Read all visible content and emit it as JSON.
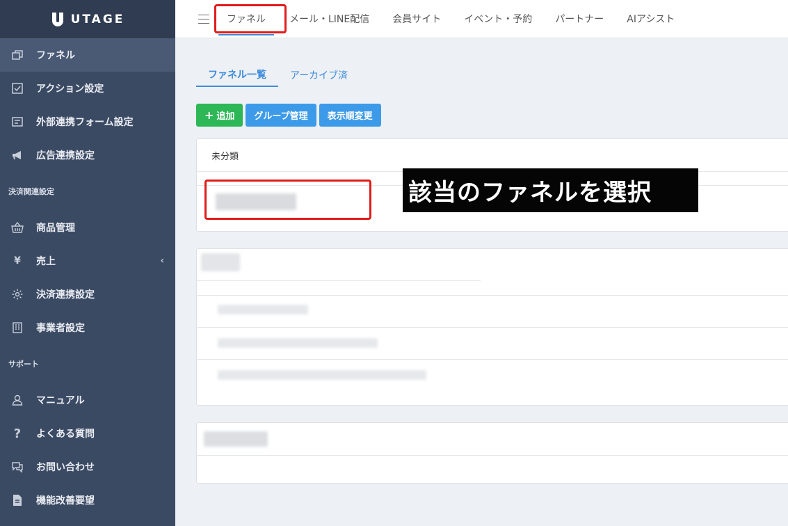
{
  "app": {
    "logo_text": "UTAGE"
  },
  "sidebar": {
    "items": [
      {
        "label": "ファネル",
        "icon": "copy-icon",
        "active": true
      },
      {
        "label": "アクション設定",
        "icon": "checkbox-icon"
      },
      {
        "label": "外部連携フォーム設定",
        "icon": "form-icon"
      },
      {
        "label": "広告連携設定",
        "icon": "megaphone-icon"
      }
    ],
    "section_payment": "決済関連設定",
    "payment_items": [
      {
        "label": "商品管理",
        "icon": "basket-icon"
      },
      {
        "label": "売上",
        "icon": "yen-icon",
        "chevron": "‹"
      },
      {
        "label": "決済連携設定",
        "icon": "gear-icon"
      },
      {
        "label": "事業者設定",
        "icon": "building-icon"
      }
    ],
    "section_support": "サポート",
    "support_items": [
      {
        "label": "マニュアル",
        "icon": "user-icon"
      },
      {
        "label": "よくある質問",
        "icon": "question-icon"
      },
      {
        "label": "お問い合わせ",
        "icon": "chat-icon"
      },
      {
        "label": "機能改善要望",
        "icon": "document-icon"
      }
    ]
  },
  "topnav": {
    "items": [
      "ファネル",
      "メール・LINE配信",
      "会員サイト",
      "イベント・予約",
      "パートナー",
      "AIアシスト"
    ]
  },
  "tabs": [
    "ファネル一覧",
    "アーカイブ済"
  ],
  "toolbar": {
    "add_label": "追加",
    "group_label": "グループ管理",
    "order_label": "表示順変更"
  },
  "card1": {
    "heading": "未分類"
  },
  "annotation": {
    "text": "該当のファネルを選択"
  },
  "colors": {
    "sidebar": "#3b4a63",
    "accent": "#3d8bdc",
    "add_button": "#2db757",
    "highlight": "#e21b1b"
  }
}
